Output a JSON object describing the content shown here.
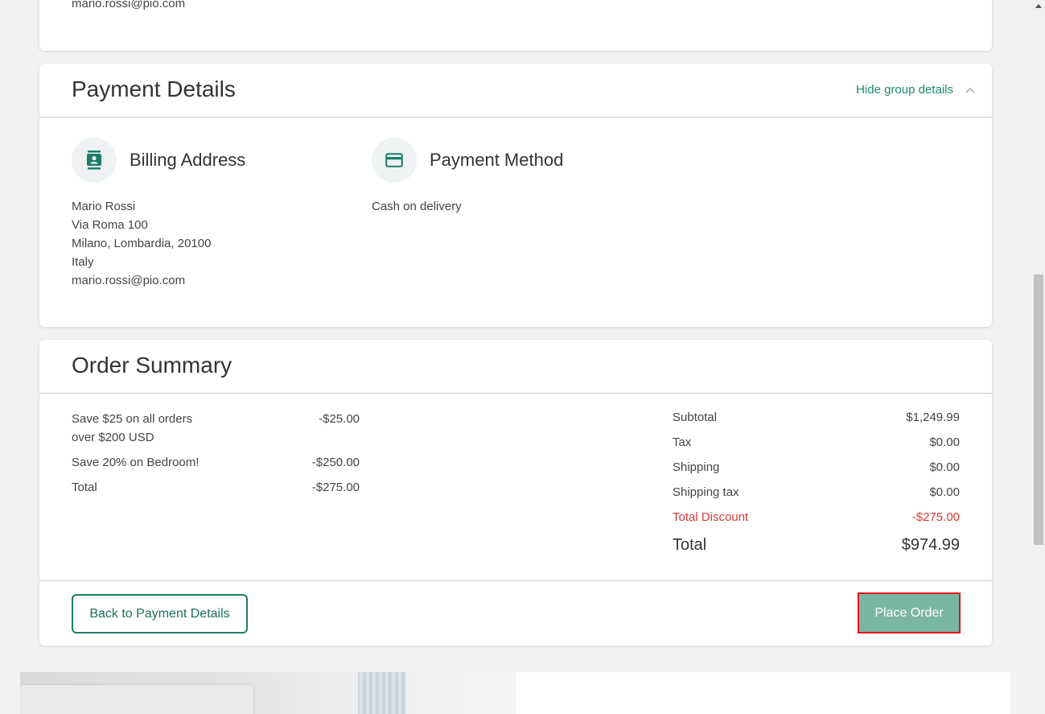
{
  "contact_card": {
    "email": "mario.rossi@pio.com"
  },
  "payment_details": {
    "title": "Payment Details",
    "hide_toggle_label": "Hide group details",
    "billing": {
      "title": "Billing Address",
      "lines": [
        "Mario Rossi",
        "Via Roma 100",
        "Milano, Lombardia, 20100",
        "Italy",
        "mario.rossi@pio.com"
      ]
    },
    "method": {
      "title": "Payment Method",
      "value": "Cash on delivery"
    }
  },
  "order_summary": {
    "title": "Order Summary",
    "discounts": [
      {
        "name": "Save $25 on all orders over $200 USD",
        "amount": "-$25.00"
      },
      {
        "name": "Save 20% on Bedroom!",
        "amount": "-$250.00"
      },
      {
        "name": "Total",
        "amount": "-$275.00"
      }
    ],
    "totals": [
      {
        "label": "Subtotal",
        "value": "$1,249.99"
      },
      {
        "label": "Tax",
        "value": "$0.00"
      },
      {
        "label": "Shipping",
        "value": "$0.00"
      },
      {
        "label": "Shipping tax",
        "value": "$0.00"
      },
      {
        "label": "Total Discount",
        "value": "-$275.00"
      },
      {
        "label": "Total",
        "value": "$974.99"
      }
    ],
    "back_button": "Back to Payment Details",
    "place_order_button": "Place Order"
  },
  "colors": {
    "accent": "#1d8a6e",
    "button_fill": "#7ab6a4",
    "discount_red": "#d9383a",
    "highlight_border": "#e0161b"
  },
  "icons": {
    "billing": "contact-card-icon",
    "method": "credit-card-icon",
    "toggle": "chevron-up-icon"
  }
}
